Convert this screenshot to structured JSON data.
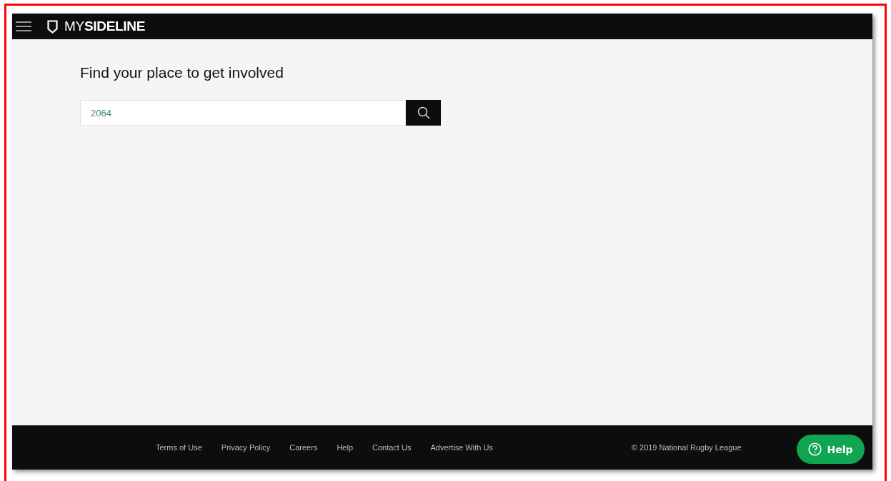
{
  "header": {
    "logo": "MY**SIDELINE**"
  },
  "main": {
    "heading": "Find your place to get involved",
    "search": {
      "value": "2064"
    }
  },
  "footer": {
    "links": [
      "Terms of Use",
      "Privacy Policy",
      "Careers",
      "Help",
      "Contact Us",
      "Advertise With Us"
    ],
    "copyright": "© 2019 National Rugby League"
  },
  "help_button": {
    "label": "Help"
  }
}
